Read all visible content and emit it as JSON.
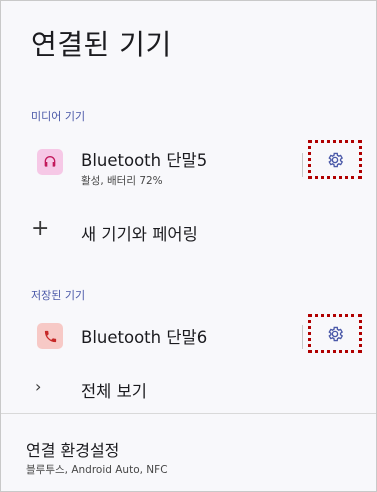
{
  "page": {
    "title": "연결된 기기"
  },
  "media_section": {
    "header": "미디어 기기",
    "device": {
      "name": "Bluetooth 단말5",
      "status": "활성, 배터리 72%",
      "icon": "headset-icon"
    }
  },
  "pair_new": {
    "label": "새 기기와 페어링",
    "icon": "plus-icon"
  },
  "saved_section": {
    "header": "저장된 기기",
    "device": {
      "name": "Bluetooth 단말6",
      "icon": "phone-icon"
    }
  },
  "view_all": {
    "label": "전체 보기",
    "icon": "chevron-right-icon"
  },
  "connection_prefs": {
    "title": "연결 환경설정",
    "subtitle": "블루투스, Android Auto, NFC"
  },
  "colors": {
    "accent": "#4a58a8",
    "headset_bg": "#f6c8e6",
    "headset_fg": "#c2185b",
    "phone_bg": "#f7c9c6",
    "phone_fg": "#c62828",
    "highlight": "#b00000"
  }
}
